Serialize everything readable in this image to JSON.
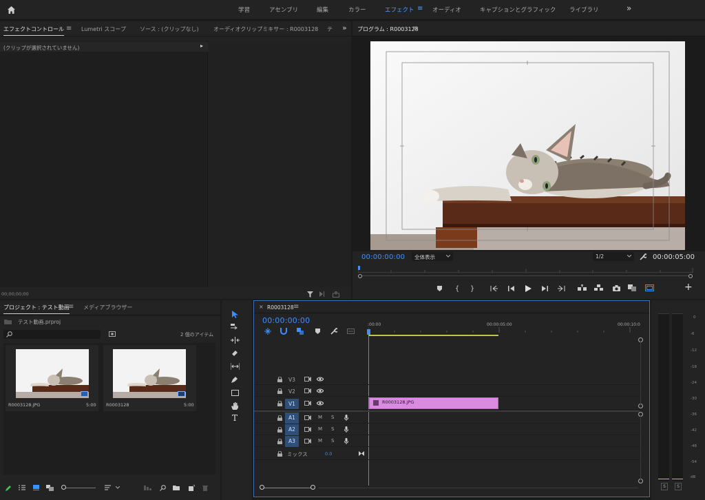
{
  "workspaces": {
    "items": [
      "学習",
      "アセンブリ",
      "編集",
      "カラー",
      "エフェクト",
      "オーディオ",
      "キャプションとグラフィック",
      "ライブラリ"
    ],
    "active": "エフェクト",
    "more": "»"
  },
  "effect_panel": {
    "tabs": [
      "エフェクトコントロール",
      "Lumetri スコープ",
      "ソース : (クリップなし)",
      "オーディオクリップミキサー : R0003128",
      "テ"
    ],
    "menu_glyph": "≡",
    "overflow": "»",
    "message": "(クリップが選択されていません)",
    "expand_glyph": "▸",
    "timecode": "00;00;00;00"
  },
  "program": {
    "title": "プログラム : R0003128",
    "menu_glyph": "≡",
    "current_tc": "00:00:00:00",
    "fit": "全体表示",
    "resolution": "1/2",
    "duration_tc": "00:00:05:00",
    "add": "+"
  },
  "project": {
    "tabs": [
      "プロジェクト : テスト動画",
      "メディアブラウザー"
    ],
    "menu_glyph": "≡",
    "file": "テスト動画.prproj",
    "search_placeholder": "",
    "count": "2 個のアイテム",
    "items": [
      {
        "name": "R0003128.JPG",
        "duration": "5:00"
      },
      {
        "name": "R0003128",
        "duration": "5:00"
      }
    ]
  },
  "timeline": {
    "close": "×",
    "title": "R0003128",
    "menu_glyph": "≡",
    "timecode": "00:00:00:00",
    "ruler": [
      ":00:00",
      "00:00:05:00",
      "00:00:10:0"
    ],
    "video_tracks": [
      "V3",
      "V2",
      "V1"
    ],
    "audio_tracks": [
      "A1",
      "A2",
      "A3"
    ],
    "mute": "M",
    "solo": "S",
    "mix_label": "ミックス",
    "mix_value": "0.0",
    "clip_name": "R0003128.JPG",
    "clip_color": "#d98be0"
  },
  "meters": {
    "scale": [
      "0",
      "-6",
      "-12",
      "-18",
      "-24",
      "-30",
      "-36",
      "-42",
      "-48",
      "-54",
      "dB"
    ],
    "solo_buttons": [
      "S",
      "S"
    ]
  },
  "colors": {
    "accent": "#3f8fff",
    "panel": "#232323",
    "background": "#1b1b1b"
  }
}
